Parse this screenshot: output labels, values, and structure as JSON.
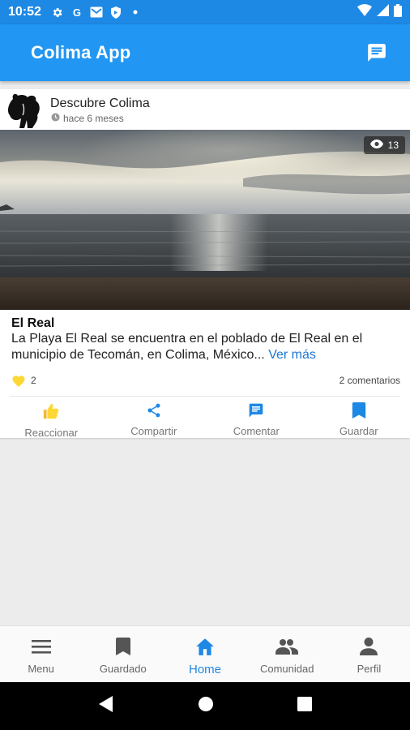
{
  "status_bar": {
    "time": "10:52",
    "icons": [
      "settings-icon",
      "google-icon",
      "gmail-icon",
      "shield-icon",
      "dot-icon"
    ],
    "right_icons": [
      "wifi-icon",
      "signal-icon",
      "battery-icon"
    ]
  },
  "app_bar": {
    "title": "Colima App",
    "action_icon": "message-icon"
  },
  "post": {
    "author": "Descubre Colima",
    "time_ago": "hace 6 meses",
    "views": "13",
    "title": "El Real",
    "description": "La Playa El Real se encuentra en el poblado de El Real en el municipio de Tecomán, en Colima, México...",
    "read_more": "Ver más",
    "likes": "2",
    "comments": "2 comentarios",
    "actions": [
      {
        "label": "Reaccionar",
        "icon": "thumbs-up-icon"
      },
      {
        "label": "Compartir",
        "icon": "share-icon"
      },
      {
        "label": "Comentar",
        "icon": "comment-icon"
      },
      {
        "label": "Guardar",
        "icon": "bookmark-icon"
      }
    ]
  },
  "bottom_nav": {
    "items": [
      {
        "label": "Menu",
        "icon": "menu-icon",
        "active": false
      },
      {
        "label": "Guardado",
        "icon": "bookmark-icon",
        "active": false
      },
      {
        "label": "Home",
        "icon": "home-icon",
        "active": true
      },
      {
        "label": "Comunidad",
        "icon": "people-icon",
        "active": false
      },
      {
        "label": "Perfil",
        "icon": "person-icon",
        "active": false
      }
    ]
  },
  "colors": {
    "primary": "#2196f3",
    "status_bar": "#1e88e5",
    "accent_link": "#1976d2",
    "like": "#fdd835"
  }
}
